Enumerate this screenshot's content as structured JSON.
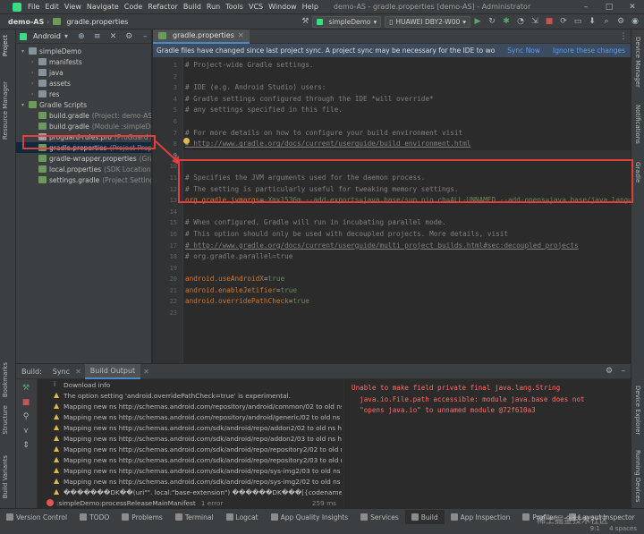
{
  "menu": {
    "items": [
      "File",
      "Edit",
      "View",
      "Navigate",
      "Code",
      "Refactor",
      "Build",
      "Run",
      "Tools",
      "VCS",
      "Window",
      "Help"
    ],
    "title": "demo-AS - gradle.properties [demo-AS] - Administrator"
  },
  "toolbar": {
    "project": "demo-AS",
    "file": "gradle.properties",
    "run_config": "simpleDemo",
    "device": "HUAWEI DBY2-W00"
  },
  "left_strip": {
    "project": "Project",
    "resource_manager": "Resource Manager",
    "bookmarks": "Bookmarks",
    "structure": "Structure",
    "build_variants": "Build Variants"
  },
  "right_strip": {
    "device_manager": "Device Manager",
    "notifications": "Notifications",
    "gradle": "Gradle",
    "device_explorer": "Device Explorer",
    "running_devices": "Running Devices"
  },
  "project_pane": {
    "view": "Android",
    "tree": [
      {
        "label": "simpleDemo",
        "hint": "",
        "indent": 0,
        "icon": "folder",
        "arrow": "▾"
      },
      {
        "label": "manifests",
        "hint": "",
        "indent": 1,
        "icon": "folder",
        "arrow": "›"
      },
      {
        "label": "java",
        "hint": "",
        "indent": 1,
        "icon": "folder",
        "arrow": "›"
      },
      {
        "label": "assets",
        "hint": "",
        "indent": 1,
        "icon": "folder",
        "arrow": "›"
      },
      {
        "label": "res",
        "hint": "",
        "indent": 1,
        "icon": "folder",
        "arrow": "›"
      },
      {
        "label": "Gradle Scripts",
        "hint": "",
        "indent": 0,
        "icon": "gradle",
        "arrow": "▾"
      },
      {
        "label": "build.gradle",
        "hint": "(Project: demo-AS)",
        "indent": 1,
        "icon": "gradle",
        "arrow": ""
      },
      {
        "label": "build.gradle",
        "hint": "(Module :simpleDemo)",
        "indent": 1,
        "icon": "gradle",
        "arrow": ""
      },
      {
        "label": "proguard-rules.pro",
        "hint": "(ProGuard Rules)",
        "indent": 1,
        "icon": "file",
        "arrow": ""
      },
      {
        "label": "gradle.properties",
        "hint": "(Project Properties)",
        "indent": 1,
        "icon": "gradle",
        "arrow": "",
        "selected": true
      },
      {
        "label": "gradle-wrapper.properties",
        "hint": "(Gradle Version)",
        "indent": 1,
        "icon": "gradle",
        "arrow": ""
      },
      {
        "label": "local.properties",
        "hint": "(SDK Location)",
        "indent": 1,
        "icon": "gradle",
        "arrow": ""
      },
      {
        "label": "settings.gradle",
        "hint": "(Project Settings)",
        "indent": 1,
        "icon": "gradle",
        "arrow": ""
      }
    ]
  },
  "editor": {
    "tab": "gradle.properties",
    "banner": "Gradle files have changed since last project sync. A project sync may be necessary for the IDE to work properly.",
    "sync_now": "Sync Now",
    "ignore": "Ignore these changes",
    "lines": [
      {
        "n": "1",
        "t": "# Project-wide Gradle settings.",
        "k": "cm"
      },
      {
        "n": "2",
        "t": "",
        "k": "cm"
      },
      {
        "n": "3",
        "t": "# IDE (e.g. Android Studio) users:",
        "k": "cm"
      },
      {
        "n": "4",
        "t": "# Gradle settings configured through the IDE *will override*",
        "k": "cm"
      },
      {
        "n": "5",
        "t": "# any settings specified in this file.",
        "k": "cm"
      },
      {
        "n": "6",
        "t": "",
        "k": "cm"
      },
      {
        "n": "7",
        "t": "# For more details on how to configure your build environment visit",
        "k": "cm"
      },
      {
        "n": "8",
        "t": "# http://www.gradle.org/docs/current/userguide/build_environment.html",
        "k": "cmu"
      },
      {
        "n": "9",
        "t": "",
        "k": "cur"
      },
      {
        "n": "10",
        "t": "",
        "k": "cm"
      },
      {
        "n": "11",
        "t": "# Specifies the JVM arguments used for the daemon process.",
        "k": "cm"
      },
      {
        "n": "12",
        "t": "# The setting is particularly useful for tweaking memory settings.",
        "k": "cm"
      },
      {
        "n": "13",
        "t": "org.gradle.jvmargs=-Xmx1536m --add-exports=java.base/sun.nio.ch=ALL-UNNAMED --add-opens=java.base/java.lang=",
        "k": "kv",
        "key": "org.gradle.jvmargs",
        "val": "-Xmx1536m --add-exports=java.base/sun.nio.ch=ALL-UNNAMED --add-opens=java.base/java.lang="
      },
      {
        "n": "14",
        "t": "",
        "k": "cm"
      },
      {
        "n": "15",
        "t": "# When configured, Gradle will run in incubating parallel mode.",
        "k": "cm"
      },
      {
        "n": "16",
        "t": "# This option should only be used with decoupled projects. More details, visit",
        "k": "cm"
      },
      {
        "n": "17",
        "t": "# http://www.gradle.org/docs/current/userguide/multi_project_builds.html#sec:decoupled_projects",
        "k": "cmu"
      },
      {
        "n": "18",
        "t": "# org.gradle.parallel=true",
        "k": "cm"
      },
      {
        "n": "19",
        "t": "",
        "k": "cm"
      },
      {
        "n": "20",
        "t": "android.useAndroidX=true",
        "k": "kv",
        "key": "android.useAndroidX",
        "val": "true"
      },
      {
        "n": "21",
        "t": "android.enableJetifier=true",
        "k": "kv",
        "key": "android.enableJetifier",
        "val": "true"
      },
      {
        "n": "22",
        "t": "android.overridePathCheck=true",
        "k": "kv",
        "key": "android.overridePathCheck",
        "val": "true"
      },
      {
        "n": "23",
        "t": "",
        "k": "cm"
      }
    ]
  },
  "build": {
    "label": "Build:",
    "tabs": [
      "Sync",
      "Build Output"
    ],
    "rows": [
      {
        "t": "Download info",
        "type": "info"
      },
      {
        "t": "The option setting 'android.overridePathCheck=true' is experimental.",
        "type": "warn"
      },
      {
        "t": "Mapping new ns http://schemas.android.com/repository/android/common/02 to old ns http",
        "type": "warn"
      },
      {
        "t": "Mapping new ns http://schemas.android.com/repository/android/generic/02 to old ns http",
        "type": "warn"
      },
      {
        "t": "Mapping new ns http://schemas.android.com/sdk/android/repo/addon2/02 to old ns http://",
        "type": "warn"
      },
      {
        "t": "Mapping new ns http://schemas.android.com/sdk/android/repo/addon2/03 to old ns http://",
        "type": "warn"
      },
      {
        "t": "Mapping new ns http://schemas.android.com/sdk/android/repo/repository2/02 to old ns htt",
        "type": "warn"
      },
      {
        "t": "Mapping new ns http://schemas.android.com/sdk/android/repo/repository2/03 to old ns htt",
        "type": "warn"
      },
      {
        "t": "Mapping new ns http://schemas.android.com/sdk/android/repo/sys-img2/03 to old ns http://",
        "type": "warn"
      },
      {
        "t": "Mapping new ns http://schemas.android.com/sdk/android/repo/sys-img2/02 to old ns http://",
        "type": "warn"
      },
      {
        "t": "�������DK��(uri\"\". local:\"base-extension\") ������DK���[{codename>.<{layoutli",
        "type": "warn"
      },
      {
        "t": ":simpleDemo:processReleaseMainManifest",
        "type": "err",
        "suffix": "1 error",
        "time": "259 ms"
      },
      {
        "t": "Unable to make field private final java.lang.String java.io.File.path accessible: module java.ba:",
        "type": "errsel"
      }
    ],
    "detail": [
      "Unable to make field private final java.lang.String",
      "  java.io.File.path accessible: module java.base does not",
      "  \"opens java.io\" to unnamed module @72f610a3"
    ]
  },
  "statusbar": {
    "items": [
      "Version Control",
      "TODO",
      "Problems",
      "Terminal",
      "Logcat",
      "App Quality Insights",
      "Services",
      "Build",
      "App Inspection",
      "Profiler",
      "Layout Inspector"
    ],
    "active": "Build",
    "right": "4 spaces",
    "pos": "9:1"
  },
  "watermark": "稀土掘金技术社区"
}
